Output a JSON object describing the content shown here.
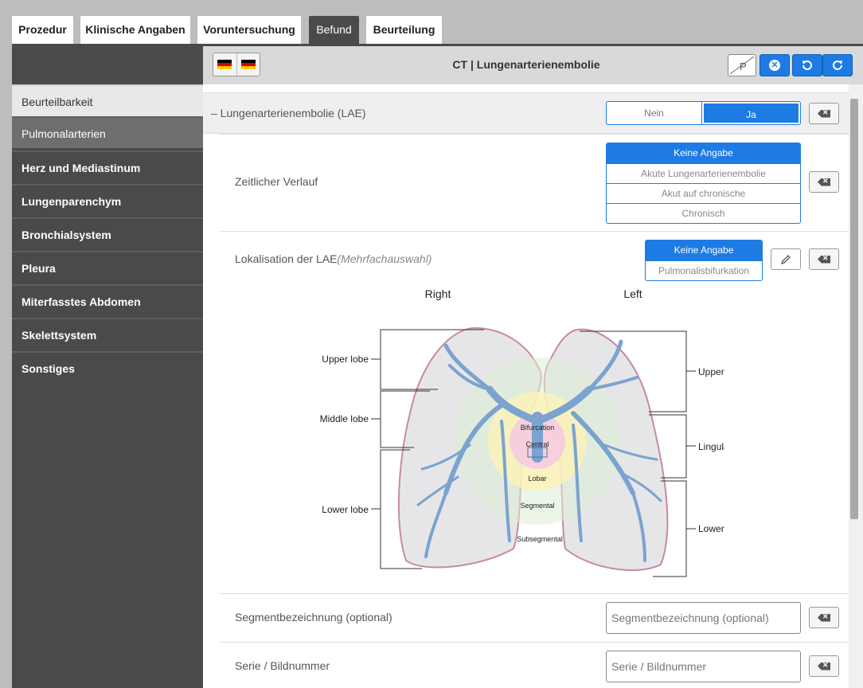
{
  "tabs": [
    {
      "label": "Prozedur",
      "active": false
    },
    {
      "label": "Klinische Angaben",
      "active": false
    },
    {
      "label": "Voruntersuchung",
      "active": false
    },
    {
      "label": "Befund",
      "active": true
    },
    {
      "label": "Beurteilung",
      "active": false
    }
  ],
  "sidebar": {
    "items": [
      {
        "label": "Beurteilbarkeit"
      },
      {
        "label": "Pulmonalarterien"
      },
      {
        "label": "Herz und Mediastinum"
      },
      {
        "label": "Lungenparenchym"
      },
      {
        "label": "Bronchialsystem"
      },
      {
        "label": "Pleura"
      },
      {
        "label": "Miterfasstes Abdomen"
      },
      {
        "label": "Skelettsystem"
      },
      {
        "label": "Sonstiges"
      }
    ]
  },
  "header": {
    "title": "CT | Lungenarterienembolie",
    "p_button": "P"
  },
  "lae": {
    "label": "– Lungenarterienembolie (LAE)",
    "options": [
      "Nein",
      "Ja"
    ],
    "selected": "Ja"
  },
  "zeitlich": {
    "label": "Zeitlicher Verlauf",
    "options": [
      "Keine Angabe",
      "Akute Lungenarterienembolie",
      "Akut auf chronische",
      "Chronisch"
    ],
    "selected": "Keine Angabe"
  },
  "lokalisation": {
    "label": "Lokalisation der LAE",
    "label_hint": "(Mehrfachauswahl)",
    "options": [
      "Keine Angabe",
      "Pulmonalisbifurkation"
    ],
    "selected": "Keine Angabe"
  },
  "diagram": {
    "right_title": "Right",
    "left_title": "Left",
    "right_lobes": [
      "Upper lobe",
      "Middle lobe",
      "Lower lobe"
    ],
    "left_lobes": [
      "Upper lobe",
      "Lingula",
      "Lower lobe"
    ],
    "zones": [
      "Bifurcation",
      "Central",
      "Lobar",
      "Segmental",
      "Subsegmental"
    ]
  },
  "segment": {
    "label": "Segmentbezeichnung (optional)",
    "placeholder": "Segmentbezeichnung (optional)"
  },
  "serie": {
    "label": "Serie / Bildnummer",
    "placeholder": "Serie / Bildnummer"
  },
  "colors": {
    "accent": "#1e7be4",
    "sidebar": "#4a4a4a",
    "vessel": "#7aa3d0",
    "lung_fill": "#e6e6e8",
    "lung_stroke": "#c98aa0"
  },
  "icons": {
    "flags": [
      "flag-de-icon",
      "flag-de-icon"
    ],
    "clear": "backspace-icon",
    "edit": "pencil-icon",
    "reset": "x-circle-icon",
    "undo": "undo-icon",
    "redo": "redo-icon"
  }
}
